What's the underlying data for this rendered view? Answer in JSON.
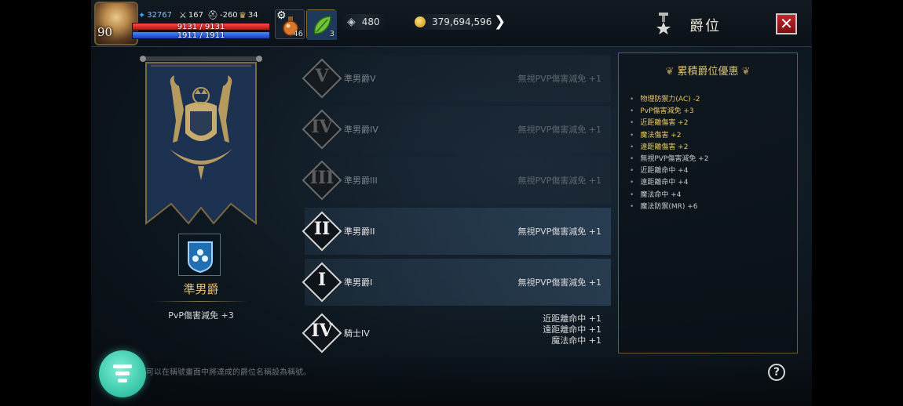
{
  "player": {
    "level": "90",
    "power": "32767",
    "attack": "167",
    "defense": "-260",
    "trophy": "34",
    "hp_text": "9131 / 9131",
    "mp_text": "1911 / 1911",
    "hp_fraction": 1.0,
    "mp_fraction": 1.0
  },
  "quick_slots": [
    {
      "icon": "potion-icon",
      "count": "46"
    },
    {
      "icon": "herb-icon",
      "count": "3"
    }
  ],
  "currency": {
    "gems": "480",
    "gold": "379,694,596"
  },
  "header": {
    "title": "爵位"
  },
  "current_rank": {
    "name": "準男爵",
    "bonus": "PvP傷害減免 +3"
  },
  "ranks": [
    {
      "roman": "V",
      "name": "準男爵V",
      "effects": [
        "無視PVP傷害減免 +1"
      ],
      "state": "locked"
    },
    {
      "roman": "IV",
      "name": "準男爵IV",
      "effects": [
        "無視PVP傷害減免 +1"
      ],
      "state": "locked"
    },
    {
      "roman": "III",
      "name": "準男爵III",
      "effects": [
        "無視PVP傷害減免 +1"
      ],
      "state": "locked"
    },
    {
      "roman": "II",
      "name": "準男爵II",
      "effects": [
        "無視PVP傷害減免 +1"
      ],
      "state": "active"
    },
    {
      "roman": "I",
      "name": "準男爵I",
      "effects": [
        "無視PVP傷害減免 +1"
      ],
      "state": "active"
    },
    {
      "roman": "IV",
      "name": "騎士IV",
      "effects": [
        "近距離命中 +1",
        "遠距離命中 +1",
        "魔法命中 +1"
      ],
      "state": "owned"
    }
  ],
  "accumulated": {
    "title": "累積爵位優惠",
    "items": [
      {
        "text": "物理防禦力(AC) -2",
        "highlight": true
      },
      {
        "text": "PvP傷害減免 +3",
        "highlight": true
      },
      {
        "text": "近距離傷害 +2",
        "highlight": true
      },
      {
        "text": "魔法傷害 +2",
        "highlight": true
      },
      {
        "text": "遠距離傷害 +2",
        "highlight": true
      },
      {
        "text": "無視PVP傷害減免 +2",
        "highlight": false
      },
      {
        "text": "近距離命中 +4",
        "highlight": false
      },
      {
        "text": "遠距離命中 +4",
        "highlight": false
      },
      {
        "text": "魔法命中 +4",
        "highlight": false
      },
      {
        "text": "魔法防禦(MR) +6",
        "highlight": false
      }
    ]
  },
  "footer": {
    "hint": "可以在稱號畫面中將達成的爵位名稱設為稱號。",
    "help_label": "?"
  },
  "colors": {
    "accent_gold": "#e8c06a",
    "close_red": "#c1272d",
    "fab_teal": "#35c3a6"
  }
}
